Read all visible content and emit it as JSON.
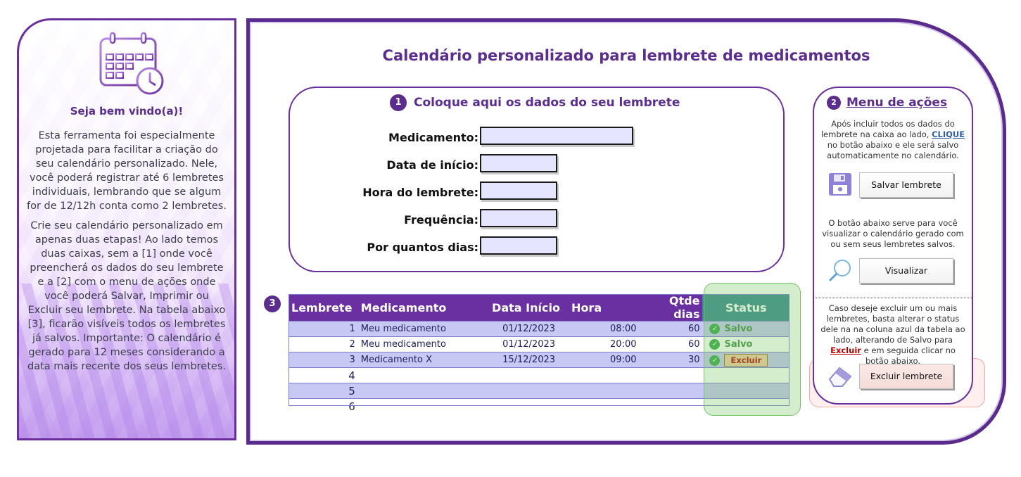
{
  "welcome": {
    "title": "Seja bem vindo(a)!",
    "para1": "Esta ferramenta foi especialmente projetada para facilitar a criação do seu calendário personalizado. Nele, você poderá registrar até 6 lembretes individuais, lembrando que se algum for de 12/12h conta como 2 lembretes.",
    "para2": "Crie seu calendário personalizado em apenas duas etapas! Ao lado temos duas caixas, sem a [1] onde você preencherá os dados do seu lembrete e a [2] com o menu de ações onde você poderá Salvar, Imprimir ou Excluir seu lembrete. Na tabela abaixo [3], ficarão visíveis todos os lembretes já salvos. Importante: O calendário é gerado para 12 meses considerando a data mais recente dos seus lembretes.",
    "icon": "calendar-clock-icon"
  },
  "main": {
    "title": "Calendário personalizado para lembrete de medicamentos"
  },
  "form": {
    "step": "1",
    "header": "Coloque aqui os dados do seu lembrete",
    "fields": {
      "medicamento": "Medicamento:",
      "data_inicio": "Data de início:",
      "hora": "Hora do lembrete:",
      "frequencia": "Frequência:",
      "dias": "Por quantos dias:"
    }
  },
  "actions": {
    "step": "2",
    "header": "Menu de ações",
    "text1_a": "Após incluir todos os dados do lembrete na caixa ao lado, ",
    "text1_link": "CLIQUE",
    "text1_b": " no botão abaixo e ele será salvo automaticamente no calendário.",
    "save_label": "Salvar lembrete",
    "text2": "O botão abaixo serve para você visualizar o calendário gerado com ou sem seus lembretes salvos.",
    "view_label": "Visualizar",
    "text3_a": "Caso deseje excluir um ou mais lembretes, basta alterar o status dele na na coluna azul da tabela ao lado, alterando de Salvo para ",
    "text3_red": "Excluir",
    "text3_b": " e em seguida clicar no botão abaixo.",
    "delete_label": "Excluir lembrete",
    "icons": {
      "save": "floppy-disk-icon",
      "view": "magnifier-icon",
      "delete": "eraser-icon"
    },
    "colors": {
      "accent": "#5b2d8e",
      "link": "#2f5faa",
      "danger": "#c00000"
    }
  },
  "table": {
    "step": "3",
    "headers": [
      "Lembrete",
      "Medicamento",
      "Data Início",
      "Hora",
      "Qtde dias",
      "Status"
    ],
    "rows": [
      {
        "n": "1",
        "med": "Meu medicamento",
        "data": "01/12/2023",
        "hora": "08:00",
        "dias": "60",
        "status": "Salvo"
      },
      {
        "n": "2",
        "med": "Meu medicamento",
        "data": "01/12/2023",
        "hora": "20:00",
        "dias": "60",
        "status": "Salvo"
      },
      {
        "n": "3",
        "med": "Medicamento X",
        "data": "15/12/2023",
        "hora": "09:00",
        "dias": "30",
        "status": "Excluir"
      },
      {
        "n": "4"
      },
      {
        "n": "5"
      },
      {
        "n": "6"
      }
    ],
    "colors": {
      "header": "#6a2fa0",
      "status_header": "#3a8a92",
      "row_alt": "#c8c8f5"
    }
  }
}
